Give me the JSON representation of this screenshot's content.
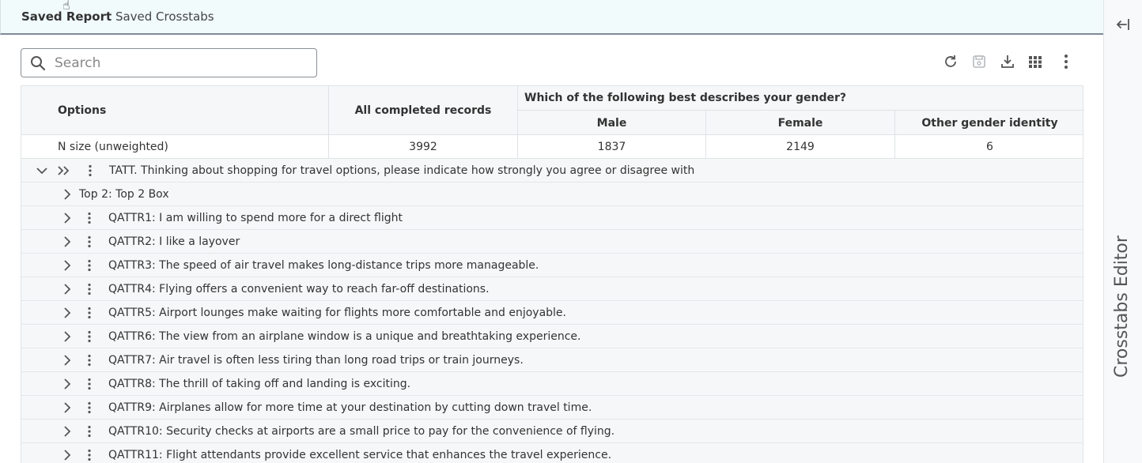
{
  "header": {
    "title_strong": "Saved Report",
    "title_rest": "Saved Crosstabs"
  },
  "side_panel": {
    "title": "Crosstabs Editor"
  },
  "search": {
    "placeholder": "Search"
  },
  "toolbar": [
    "refresh-icon",
    "save-icon",
    "download-icon",
    "grid-icon",
    "more-vertical-icon"
  ],
  "table": {
    "options_header": "Options",
    "all_header": "All completed records",
    "question_header": "Which of the following best describes your gender?",
    "sub_headers": [
      "Male",
      "Female",
      "Other gender identity"
    ],
    "n_size": {
      "label": "N size (unweighted)",
      "all": "3992",
      "values": [
        "1837",
        "2149",
        "6"
      ]
    },
    "group": {
      "label": "TATT. Thinking about shopping for travel options, please indicate how strongly you agree or disagree with"
    },
    "top_box": {
      "label": "Top 2: Top 2 Box"
    },
    "items": [
      "QATTR1: I am willing to spend more for a direct flight",
      "QATTR2: I like a layover",
      "QATTR3: The speed of air travel makes long-distance trips more manageable.",
      "QATTR4: Flying offers a convenient way to reach far-off destinations.",
      "QATTR5: Airport lounges make waiting for flights more comfortable and enjoyable.",
      "QATTR6: The view from an airplane window is a unique and breathtaking experience.",
      "QATTR7: Air travel is often less tiring than long road trips or train journeys.",
      "QATTR8: The thrill of taking off and landing is exciting.",
      "QATTR9: Airplanes allow for more time at your destination by cutting down travel time.",
      "QATTR10: Security checks at airports are a small price to pay for the convenience of flying.",
      "QATTR11: Flight attendants provide excellent service that enhances the travel experience."
    ]
  }
}
